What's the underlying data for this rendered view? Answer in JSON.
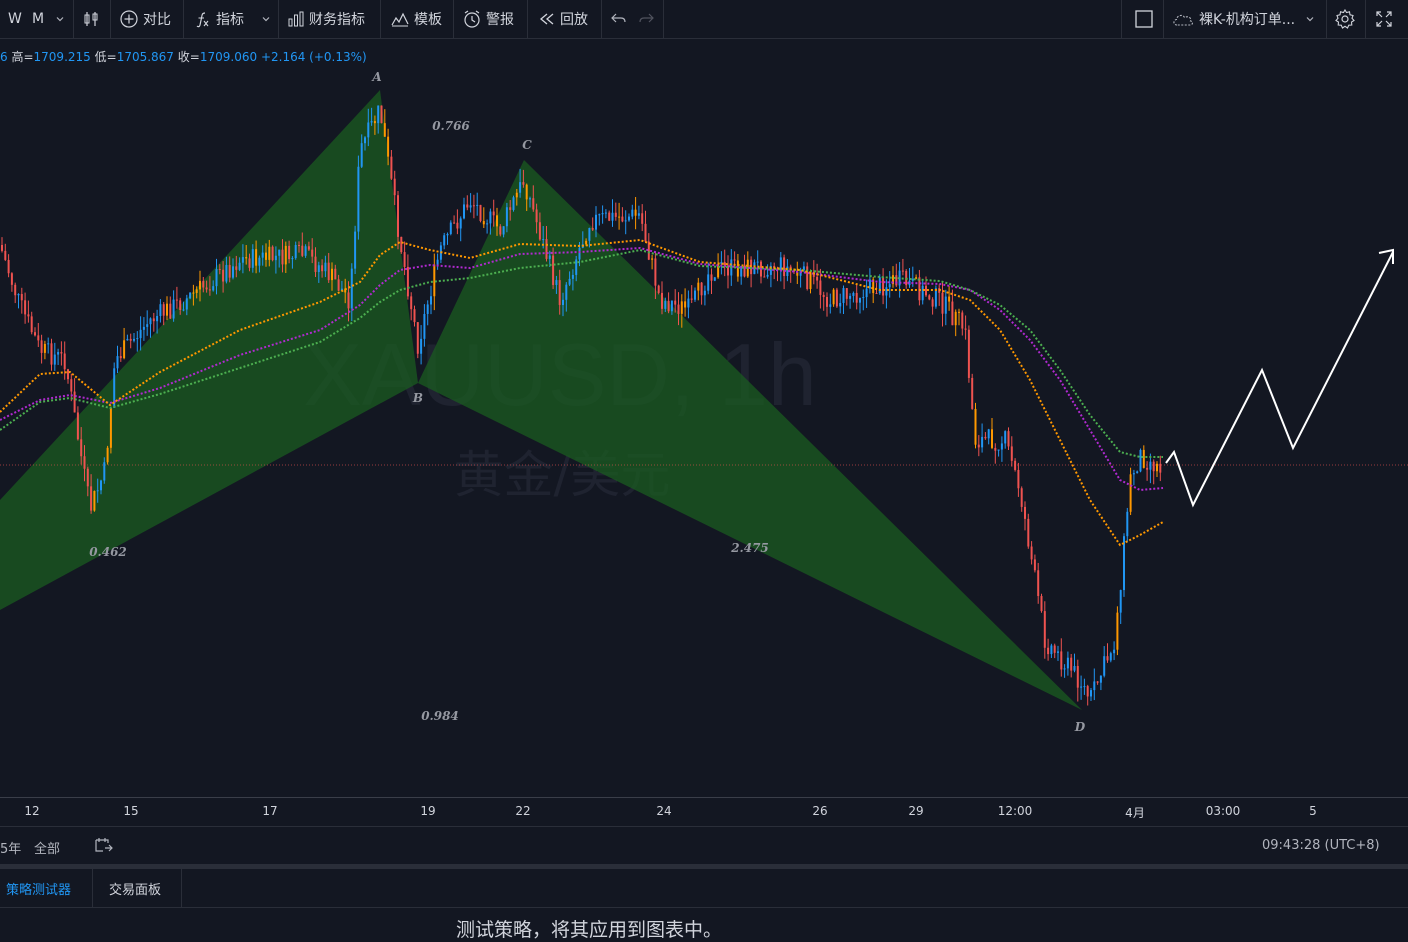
{
  "toolbar": {
    "interval_w": "W",
    "interval_m": "M",
    "compare": "对比",
    "indicators": "指标",
    "financials": "财务指标",
    "templates": "模板",
    "alert": "警报",
    "replay": "回放",
    "script": "裸K-机构订单..."
  },
  "ohlc": {
    "prefix": "6",
    "high_label": "高=",
    "high": "1709.215",
    "low_label": "低=",
    "low": "1705.867",
    "close_label": "收=",
    "close": "1709.060",
    "change": "+2.164 (+0.13%)"
  },
  "watermark": {
    "symbol": "XAUUSD, 1h",
    "name": "黄金/美元"
  },
  "pattern": {
    "points": [
      "A",
      "B",
      "C",
      "D"
    ],
    "ratios": [
      "0.766",
      "0.462",
      "2.475",
      "0.984"
    ]
  },
  "time_axis": [
    "12",
    "15",
    "17",
    "19",
    "22",
    "24",
    "26",
    "29",
    "12:00",
    "4月",
    "03:00",
    "5"
  ],
  "range_bar": {
    "partial_5y": "5年",
    "all": "全部",
    "clock": "09:43:28 (UTC+8)"
  },
  "tabs": {
    "strategy_tester": "策略测试器",
    "trading_panel": "交易面板"
  },
  "message": "测试策略，将其应用到图表中。",
  "colors": {
    "background": "#131722",
    "pattern_fill": "#1b5e20",
    "candle_up": "#2196f3",
    "candle_down": "#ef5350",
    "candle_orange": "#ff9800",
    "ma_orange": "#ff9800",
    "ma_purple": "#b02ad0",
    "ma_green": "#4caf50",
    "accent": "#2196f3"
  }
}
